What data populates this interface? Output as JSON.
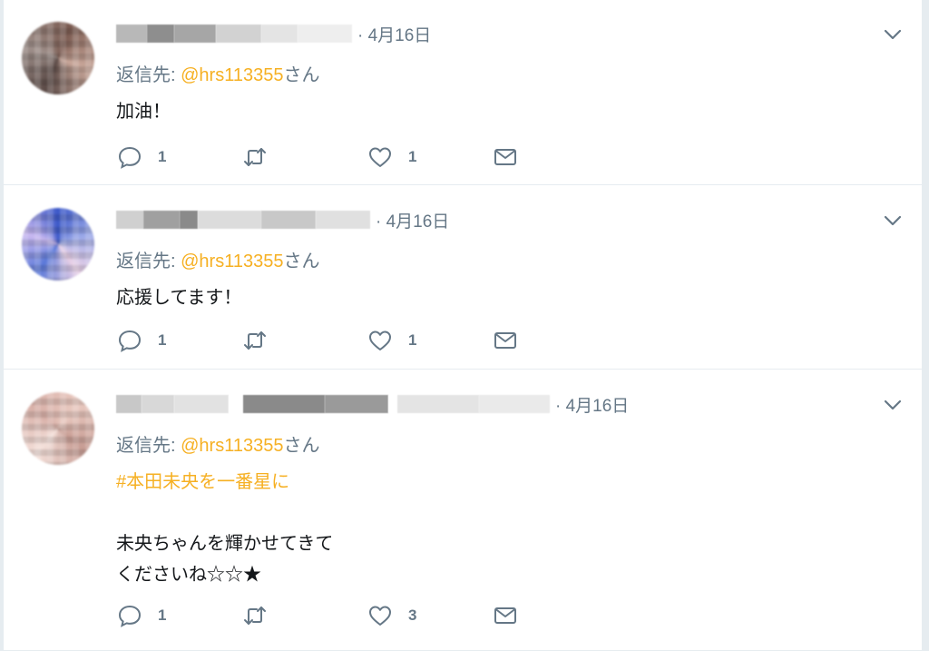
{
  "tweets": [
    {
      "time": "· 4月16日",
      "reply_prefix": "返信先: ",
      "reply_handle": "@hrs113355",
      "reply_suffix": "さん",
      "text": "加油！",
      "hashtag": "",
      "reply_count": "1",
      "retweet_count": "",
      "like_count": "1"
    },
    {
      "time": "· 4月16日",
      "reply_prefix": "返信先: ",
      "reply_handle": "@hrs113355",
      "reply_suffix": "さん",
      "text": "応援してます！",
      "hashtag": "",
      "reply_count": "1",
      "retweet_count": "",
      "like_count": "1"
    },
    {
      "time": "· 4月16日",
      "reply_prefix": "返信先: ",
      "reply_handle": "@hrs113355",
      "reply_suffix": "さん",
      "hashtag": "#本田未央を一番星に",
      "text": "未央ちゃんを輝かせてきて\nくださいね☆☆★",
      "reply_count": "1",
      "retweet_count": "",
      "like_count": "3"
    }
  ],
  "colors": {
    "accent": "#f6b023",
    "muted": "#657786",
    "text": "#14171a",
    "border": "#e6ecf0"
  },
  "icons": {
    "reply": "reply-icon",
    "retweet": "retweet-icon",
    "like": "heart-icon",
    "message": "envelope-icon",
    "more": "chevron-down-icon"
  }
}
